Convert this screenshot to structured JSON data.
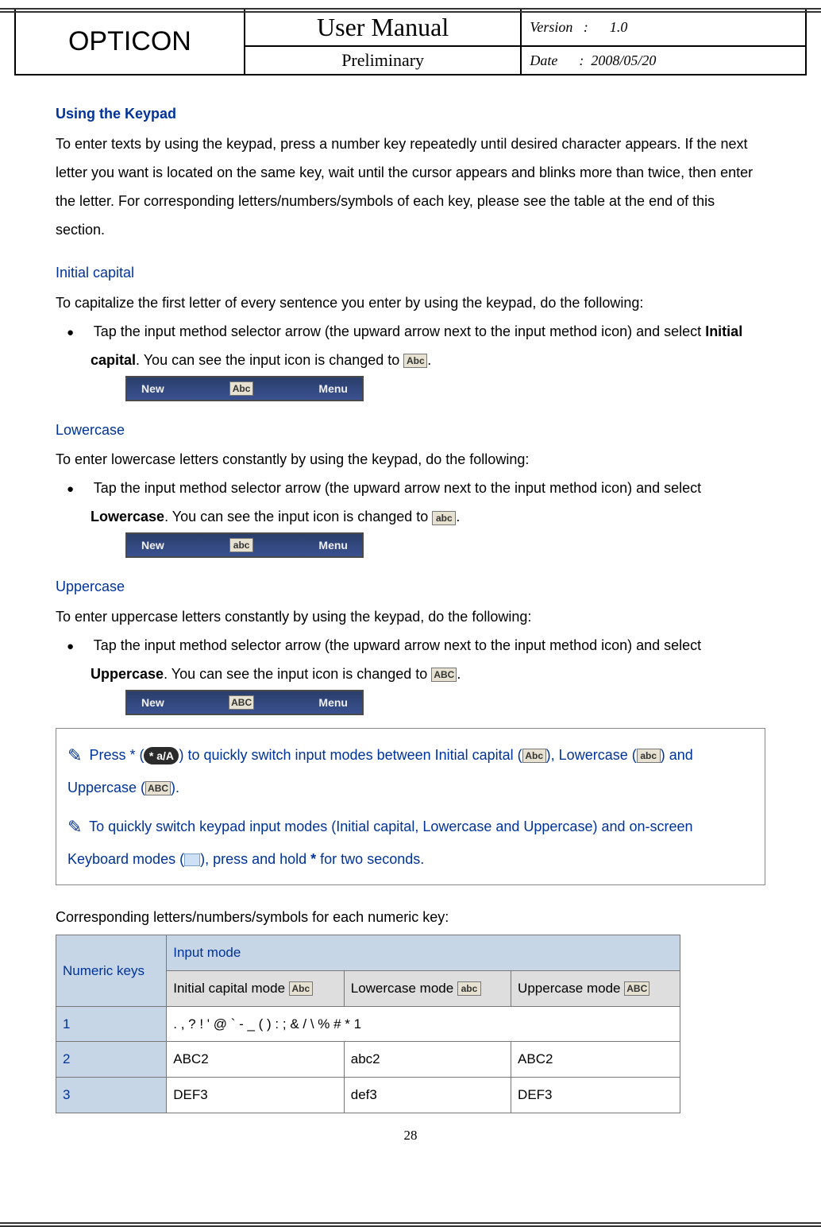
{
  "header": {
    "brand": "OPTICON",
    "title": "User Manual",
    "subtitle": "Preliminary",
    "version_label": "Version",
    "version_value": "1.0",
    "date_label": "Date",
    "date_value": "2008/05/20"
  },
  "section": {
    "heading": "Using the Keypad",
    "intro": "To enter texts by using the keypad, press a number key repeatedly until desired character appears. If the next letter you want is located on the same key, wait until the cursor appears and blinks more than twice, then enter the letter. For corresponding letters/numbers/symbols of each key, please see the table at the end of this section."
  },
  "initial_capital": {
    "heading": "Initial capital",
    "intro": "To capitalize the first letter of every sentence you enter by using the keypad, do the following:",
    "bullet_pre": "Tap the input method selector arrow (the upward arrow next to the input method icon) and select ",
    "bold_word": "Initial capital",
    "bullet_post": ". You can see the input icon is changed to ",
    "chip": "Abc",
    "softkeys": {
      "left": "New",
      "center": "Abc",
      "right": "Menu"
    }
  },
  "lowercase": {
    "heading": "Lowercase",
    "intro": "To enter lowercase letters constantly by using the keypad, do the following:",
    "bullet_pre": "Tap the input method selector arrow (the upward arrow next to the input method icon) and select ",
    "bold_word": "Lowercase",
    "bullet_post": ". You can see the input icon is changed to ",
    "chip": "abc",
    "softkeys": {
      "left": "New",
      "center": "abc",
      "right": "Menu"
    }
  },
  "uppercase": {
    "heading": "Uppercase",
    "intro": "To enter uppercase letters constantly by using the keypad, do the following:",
    "bullet_pre": "Tap the input method selector arrow (the upward arrow next to the input method icon) and select ",
    "bold_word": "Uppercase",
    "bullet_post": ". You can see the input icon is changed to ",
    "chip": "ABC",
    "softkeys": {
      "left": "New",
      "center": "ABC",
      "right": "Menu"
    }
  },
  "tips": {
    "t1_a": "Press * (",
    "t1_star": "* a/A",
    "t1_b": ") to quickly switch input modes between Initial capital (",
    "t1_c": "), Lowercase (",
    "t1_d": ") and Uppercase (",
    "t1_e": ").",
    "chip_Abc": "Abc",
    "chip_abc": "abc",
    "chip_ABC": "ABC",
    "t2_a": "To quickly switch keypad input modes (Initial capital, Lowercase and Uppercase) and on-screen Keyboard modes (",
    "t2_b": "), press and hold ",
    "t2_star": "*",
    "t2_c": " for two seconds."
  },
  "table": {
    "intro": "Corresponding letters/numbers/symbols for each numeric key:",
    "col_key": "Numeric keys",
    "col_mode": "Input mode",
    "col_initial": "Initial capital mode",
    "col_lower": "Lowercase mode",
    "col_upper": "Uppercase mode",
    "chip_Abc": "Abc",
    "chip_abc": "abc",
    "chip_ABC": "ABC",
    "rows": {
      "r1_key": "1",
      "r1_val": ". , ? ! ' @ ` - _ ( ) : ; & / \\ % # * 1",
      "r2_key": "2",
      "r2_a": "ABC2",
      "r2_b": "abc2",
      "r2_c": "ABC2",
      "r3_key": "3",
      "r3_a": "DEF3",
      "r3_b": "def3",
      "r3_c": "DEF3"
    }
  },
  "page_number": "28"
}
